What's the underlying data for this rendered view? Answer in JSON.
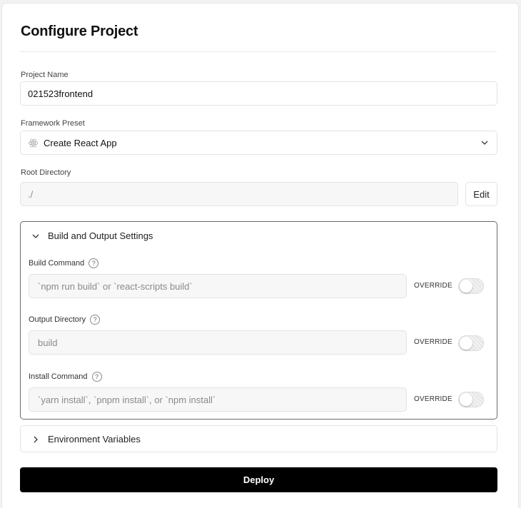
{
  "page": {
    "title": "Configure Project"
  },
  "project_name": {
    "label": "Project Name",
    "value": "021523frontend"
  },
  "framework": {
    "label": "Framework Preset",
    "value": "Create React App",
    "icon": "react-icon",
    "dropdown_icon": "chevron-down-icon"
  },
  "root_directory": {
    "label": "Root Directory",
    "value": "./",
    "edit_label": "Edit"
  },
  "build_settings": {
    "title": "Build and Output Settings",
    "expanded": true,
    "fields": [
      {
        "label": "Build Command",
        "placeholder": "`npm run build` or `react-scripts build`",
        "override_label": "OVERRIDE",
        "override_on": false
      },
      {
        "label": "Output Directory",
        "placeholder": "build",
        "override_label": "OVERRIDE",
        "override_on": false
      },
      {
        "label": "Install Command",
        "placeholder": "`yarn install`, `pnpm install`, or `npm install`",
        "override_label": "OVERRIDE",
        "override_on": false
      }
    ]
  },
  "env_vars": {
    "title": "Environment Variables",
    "expanded": false
  },
  "deploy": {
    "label": "Deploy"
  },
  "colors": {
    "accent": "#000000",
    "background": "#f2f2f2",
    "card": "#ffffff",
    "react_blue": "#61dafb"
  }
}
